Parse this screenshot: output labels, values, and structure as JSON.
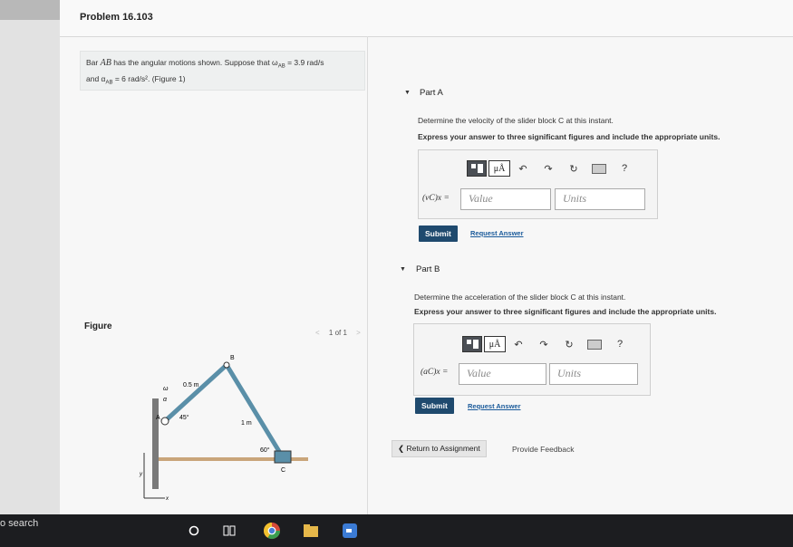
{
  "problem_title": "Problem 16.103",
  "statement": {
    "line1_pre": "Bar",
    "bar_name": "AB",
    "line1_mid": "has the angular motions shown. Suppose that ω",
    "omega_sub": "AB",
    "omega_val": " = 3.9  rad/s",
    "line2_pre": "and α",
    "alpha_sub": "AB",
    "alpha_val": " = 6  rad/s²",
    "fig_ref": ". (Figure 1)"
  },
  "figure": {
    "label": "Figure",
    "pager": "1 of 1",
    "prev": "<",
    "next": ">",
    "labels": {
      "B": "B",
      "C": "C",
      "A": "A",
      "len_ab": "0.5 m",
      "len_bc": "1 m",
      "ang_a": "45°",
      "ang_c": "60°",
      "omega": "ω",
      "alpha": "α",
      "y": "y",
      "x": "x"
    }
  },
  "partA": {
    "title": "Part A",
    "question": "Determine the velocity of the slider block C at this instant.",
    "instruction": "Express your answer to three significant figures and include the appropriate units.",
    "label": "(vC)x =",
    "value_placeholder": "Value",
    "units_placeholder": "Units",
    "submit": "Submit",
    "request": "Request Answer"
  },
  "partB": {
    "title": "Part B",
    "question": "Determine the acceleration of the slider block C at this instant.",
    "instruction": "Express your answer to three significant figures and include the appropriate units.",
    "label": "(aC)x =",
    "value_placeholder": "Value",
    "units_placeholder": "Units",
    "submit": "Submit",
    "request": "Request Answer"
  },
  "toolbar": {
    "mu": "μÅ",
    "help": "?"
  },
  "footer": {
    "return": "❮ Return to Assignment",
    "feedback": "Provide Feedback"
  },
  "taskbar": {
    "search": "o search"
  },
  "colors": {
    "submit": "#1f4a6e",
    "link": "#1a5a9a",
    "bar": "#5a8fa8",
    "floor": "#c9a57a"
  }
}
